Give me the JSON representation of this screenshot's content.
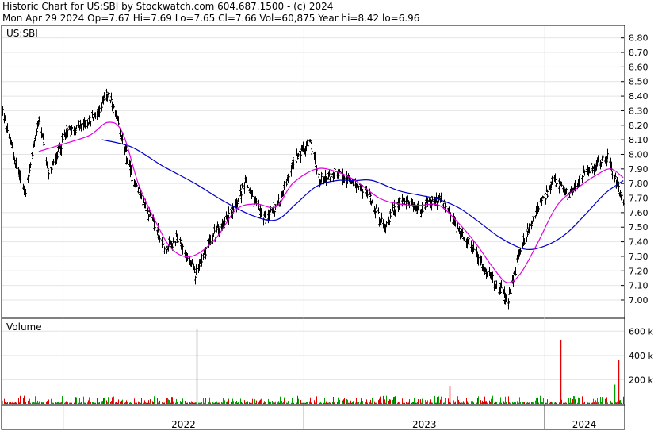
{
  "header": {
    "line1": "Historic Chart for US:SBI by Stockwatch.com 604.687.1500 - (c) 2024",
    "line2": "Mon Apr 29 2024  Op=7.67  Hi=7.69  Lo=7.65  Cl=7.66  Vol=60,875  Year hi=8.42  lo=6.96"
  },
  "colors": {
    "price_bars": "#000000",
    "ma_short": "#e000e0",
    "ma_long": "#0000c8",
    "vol_up": "#00a000",
    "vol_down": "#e00000",
    "vol_flat": "#a0a0a0",
    "grid": "#e4e4e4"
  },
  "chart_data": [
    {
      "type": "ohlc",
      "title": "US:SBI",
      "ylim": [
        6.88,
        8.88
      ],
      "yticks": [
        "8.80",
        "8.70",
        "8.60",
        "8.50",
        "8.40",
        "8.30",
        "8.20",
        "8.10",
        "8.00",
        "7.90",
        "7.80",
        "7.70",
        "7.60",
        "7.50",
        "7.40",
        "7.30",
        "7.20",
        "7.10",
        "7.00"
      ],
      "grid": true,
      "date_range": [
        "2021-10",
        "2024-04-29"
      ],
      "anchors": [
        [
          "2021-10-01",
          8.3
        ],
        [
          "2021-10-20",
          7.95
        ],
        [
          "2021-11-05",
          7.73
        ],
        [
          "2021-11-25",
          8.25
        ],
        [
          "2021-12-10",
          7.85
        ],
        [
          "2022-01-05",
          8.15
        ],
        [
          "2022-02-01",
          8.2
        ],
        [
          "2022-02-20",
          8.28
        ],
        [
          "2022-03-10",
          8.42
        ],
        [
          "2022-03-25",
          8.2
        ],
        [
          "2022-04-15",
          7.85
        ],
        [
          "2022-05-10",
          7.6
        ],
        [
          "2022-06-05",
          7.35
        ],
        [
          "2022-06-25",
          7.42
        ],
        [
          "2022-07-20",
          7.18
        ],
        [
          "2022-08-10",
          7.4
        ],
        [
          "2022-09-05",
          7.55
        ],
        [
          "2022-10-05",
          7.8
        ],
        [
          "2022-11-01",
          7.55
        ],
        [
          "2022-11-25",
          7.68
        ],
        [
          "2022-12-15",
          7.95
        ],
        [
          "2023-01-10",
          8.08
        ],
        [
          "2023-01-25",
          7.82
        ],
        [
          "2023-02-20",
          7.88
        ],
        [
          "2023-03-15",
          7.8
        ],
        [
          "2023-04-10",
          7.72
        ],
        [
          "2023-05-01",
          7.5
        ],
        [
          "2023-05-25",
          7.68
        ],
        [
          "2023-06-25",
          7.62
        ],
        [
          "2023-07-25",
          7.7
        ],
        [
          "2023-08-20",
          7.5
        ],
        [
          "2023-09-15",
          7.35
        ],
        [
          "2023-10-05",
          7.18
        ],
        [
          "2023-10-25",
          7.08
        ],
        [
          "2023-11-05",
          6.97
        ],
        [
          "2023-11-25",
          7.35
        ],
        [
          "2023-12-20",
          7.62
        ],
        [
          "2024-01-15",
          7.82
        ],
        [
          "2024-02-05",
          7.72
        ],
        [
          "2024-02-25",
          7.85
        ],
        [
          "2024-03-15",
          7.92
        ],
        [
          "2024-04-05",
          7.98
        ],
        [
          "2024-04-20",
          7.78
        ],
        [
          "2024-04-29",
          7.66
        ]
      ],
      "last_bar": {
        "date": "2024-04-29",
        "open": 7.67,
        "high": 7.69,
        "low": 7.65,
        "close": 7.66
      },
      "ma_short": [
        [
          "2021-11-25",
          8.02
        ],
        [
          "2022-01-01",
          8.07
        ],
        [
          "2022-02-10",
          8.13
        ],
        [
          "2022-03-10",
          8.22
        ],
        [
          "2022-04-01",
          8.15
        ],
        [
          "2022-04-25",
          7.8
        ],
        [
          "2022-05-20",
          7.55
        ],
        [
          "2022-06-15",
          7.35
        ],
        [
          "2022-07-15",
          7.3
        ],
        [
          "2022-08-20",
          7.42
        ],
        [
          "2022-09-20",
          7.62
        ],
        [
          "2022-10-20",
          7.66
        ],
        [
          "2022-11-20",
          7.64
        ],
        [
          "2022-12-15",
          7.8
        ],
        [
          "2023-01-20",
          7.9
        ],
        [
          "2023-02-20",
          7.88
        ],
        [
          "2023-03-20",
          7.82
        ],
        [
          "2023-04-25",
          7.7
        ],
        [
          "2023-05-25",
          7.66
        ],
        [
          "2023-06-25",
          7.65
        ],
        [
          "2023-07-25",
          7.65
        ],
        [
          "2023-08-25",
          7.52
        ],
        [
          "2023-09-20",
          7.38
        ],
        [
          "2023-10-15",
          7.22
        ],
        [
          "2023-11-05",
          7.12
        ],
        [
          "2023-11-25",
          7.18
        ],
        [
          "2023-12-20",
          7.38
        ],
        [
          "2024-01-20",
          7.65
        ],
        [
          "2024-02-20",
          7.77
        ],
        [
          "2024-03-20",
          7.86
        ],
        [
          "2024-04-10",
          7.9
        ],
        [
          "2024-04-29",
          7.84
        ]
      ],
      "ma_long": [
        [
          "2022-03-01",
          8.1
        ],
        [
          "2022-04-15",
          8.05
        ],
        [
          "2022-06-01",
          7.92
        ],
        [
          "2022-07-20",
          7.8
        ],
        [
          "2022-09-01",
          7.68
        ],
        [
          "2022-10-15",
          7.58
        ],
        [
          "2022-11-20",
          7.55
        ],
        [
          "2022-12-20",
          7.66
        ],
        [
          "2023-01-20",
          7.78
        ],
        [
          "2023-02-20",
          7.82
        ],
        [
          "2023-03-20",
          7.82
        ],
        [
          "2023-04-15",
          7.82
        ],
        [
          "2023-05-25",
          7.75
        ],
        [
          "2023-06-25",
          7.72
        ],
        [
          "2023-07-25",
          7.69
        ],
        [
          "2023-08-25",
          7.63
        ],
        [
          "2023-09-25",
          7.53
        ],
        [
          "2023-10-25",
          7.43
        ],
        [
          "2023-12-01",
          7.35
        ],
        [
          "2024-01-01",
          7.37
        ],
        [
          "2024-02-01",
          7.45
        ],
        [
          "2024-03-01",
          7.58
        ],
        [
          "2024-04-01",
          7.73
        ],
        [
          "2024-04-29",
          7.82
        ]
      ]
    },
    {
      "type": "bar",
      "title": "Volume",
      "ylim": [
        0,
        700000
      ],
      "yticks": [
        {
          "value": 600000,
          "label": "600 k"
        },
        {
          "value": 400000,
          "label": "400 k"
        },
        {
          "value": 200000,
          "label": "200 k"
        }
      ],
      "spikes": [
        {
          "date": "2022-07-22",
          "value": 620000,
          "dir": "flat"
        },
        {
          "date": "2024-01-25",
          "value": 530000,
          "dir": "down"
        },
        {
          "date": "2024-04-22",
          "value": 360000,
          "dir": "down"
        },
        {
          "date": "2023-08-10",
          "value": 150000,
          "dir": "down"
        },
        {
          "date": "2024-04-15",
          "value": 160000,
          "dir": "up"
        }
      ],
      "last_volume": 60875
    },
    {
      "type": "axis",
      "xticks": [
        "2022",
        "2023",
        "2024"
      ]
    }
  ]
}
